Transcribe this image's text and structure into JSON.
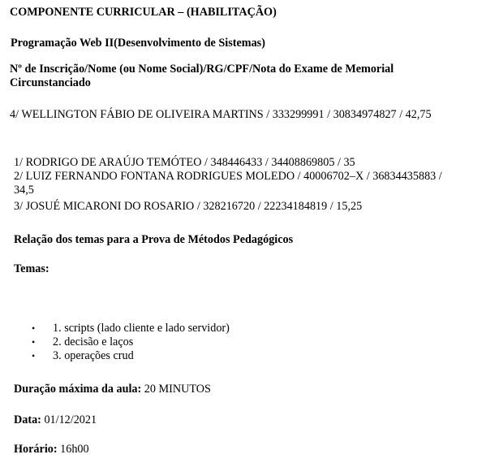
{
  "header": {
    "component_title": "COMPONENTE CURRICULAR – (HABILITAÇÃO)",
    "course_title": "Programação Web II(Desenvolvimento de Sistemas)"
  },
  "candidates": {
    "column_header": "Nº de Inscrição/Nome (ou Nome Social)/RG/CPF/Nota do Exame de Memorial Circunstanciado",
    "first_entry": "4/ WELLINGTON FÁBIO DE OLIVEIRA MARTINS / 333299991 / 30834974827 / 42,75",
    "entries": [
      "1/ RODRIGO DE ARAÚJO TEMÓTEO / 348446433 / 34408869805 / 35",
      "2/ LUIZ FERNANDO FONTANA RODRIGUES MOLEDO / 40006702–X / 36834435883 / 34,5",
      "3/ JOSUÉ MICARONI DO ROSARIO / 328216720 / 22234184819 / 15,25"
    ]
  },
  "topics_section": {
    "heading": "Relação dos temas para a Prova de Métodos Pedagógicos",
    "label": "Temas:",
    "bullet_glyph": "•",
    "items": [
      "1. scripts (lado cliente e lado servidor)",
      "2. decisão e laços",
      "3. operações crud"
    ]
  },
  "details": {
    "duration_label": "Duração máxima da aula:",
    "duration_value": "20 MINUTOS",
    "date_label": "Data:",
    "date_value": "01/12/2021",
    "time_label": "Horário:",
    "time_value": "16h00"
  }
}
